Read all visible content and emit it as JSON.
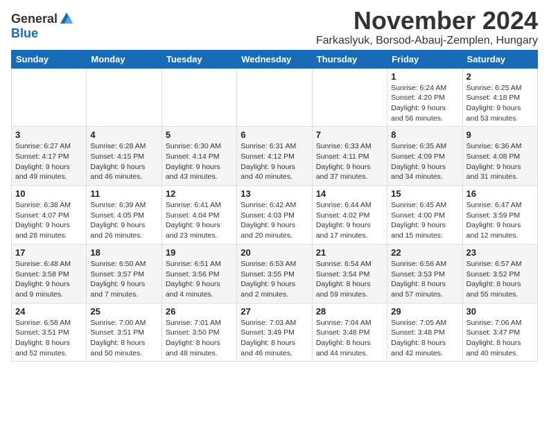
{
  "header": {
    "logo_general": "General",
    "logo_blue": "Blue",
    "month_year": "November 2024",
    "location": "Farkaslyuk, Borsod-Abauj-Zemplen, Hungary"
  },
  "weekdays": [
    "Sunday",
    "Monday",
    "Tuesday",
    "Wednesday",
    "Thursday",
    "Friday",
    "Saturday"
  ],
  "weeks": [
    [
      {
        "day": "",
        "info": ""
      },
      {
        "day": "",
        "info": ""
      },
      {
        "day": "",
        "info": ""
      },
      {
        "day": "",
        "info": ""
      },
      {
        "day": "",
        "info": ""
      },
      {
        "day": "1",
        "info": "Sunrise: 6:24 AM\nSunset: 4:20 PM\nDaylight: 9 hours\nand 56 minutes."
      },
      {
        "day": "2",
        "info": "Sunrise: 6:25 AM\nSunset: 4:18 PM\nDaylight: 9 hours\nand 53 minutes."
      }
    ],
    [
      {
        "day": "3",
        "info": "Sunrise: 6:27 AM\nSunset: 4:17 PM\nDaylight: 9 hours\nand 49 minutes."
      },
      {
        "day": "4",
        "info": "Sunrise: 6:28 AM\nSunset: 4:15 PM\nDaylight: 9 hours\nand 46 minutes."
      },
      {
        "day": "5",
        "info": "Sunrise: 6:30 AM\nSunset: 4:14 PM\nDaylight: 9 hours\nand 43 minutes."
      },
      {
        "day": "6",
        "info": "Sunrise: 6:31 AM\nSunset: 4:12 PM\nDaylight: 9 hours\nand 40 minutes."
      },
      {
        "day": "7",
        "info": "Sunrise: 6:33 AM\nSunset: 4:11 PM\nDaylight: 9 hours\nand 37 minutes."
      },
      {
        "day": "8",
        "info": "Sunrise: 6:35 AM\nSunset: 4:09 PM\nDaylight: 9 hours\nand 34 minutes."
      },
      {
        "day": "9",
        "info": "Sunrise: 6:36 AM\nSunset: 4:08 PM\nDaylight: 9 hours\nand 31 minutes."
      }
    ],
    [
      {
        "day": "10",
        "info": "Sunrise: 6:38 AM\nSunset: 4:07 PM\nDaylight: 9 hours\nand 28 minutes."
      },
      {
        "day": "11",
        "info": "Sunrise: 6:39 AM\nSunset: 4:05 PM\nDaylight: 9 hours\nand 26 minutes."
      },
      {
        "day": "12",
        "info": "Sunrise: 6:41 AM\nSunset: 4:04 PM\nDaylight: 9 hours\nand 23 minutes."
      },
      {
        "day": "13",
        "info": "Sunrise: 6:42 AM\nSunset: 4:03 PM\nDaylight: 9 hours\nand 20 minutes."
      },
      {
        "day": "14",
        "info": "Sunrise: 6:44 AM\nSunset: 4:02 PM\nDaylight: 9 hours\nand 17 minutes."
      },
      {
        "day": "15",
        "info": "Sunrise: 6:45 AM\nSunset: 4:00 PM\nDaylight: 9 hours\nand 15 minutes."
      },
      {
        "day": "16",
        "info": "Sunrise: 6:47 AM\nSunset: 3:59 PM\nDaylight: 9 hours\nand 12 minutes."
      }
    ],
    [
      {
        "day": "17",
        "info": "Sunrise: 6:48 AM\nSunset: 3:58 PM\nDaylight: 9 hours\nand 9 minutes."
      },
      {
        "day": "18",
        "info": "Sunrise: 6:50 AM\nSunset: 3:57 PM\nDaylight: 9 hours\nand 7 minutes."
      },
      {
        "day": "19",
        "info": "Sunrise: 6:51 AM\nSunset: 3:56 PM\nDaylight: 9 hours\nand 4 minutes."
      },
      {
        "day": "20",
        "info": "Sunrise: 6:53 AM\nSunset: 3:55 PM\nDaylight: 9 hours\nand 2 minutes."
      },
      {
        "day": "21",
        "info": "Sunrise: 6:54 AM\nSunset: 3:54 PM\nDaylight: 8 hours\nand 59 minutes."
      },
      {
        "day": "22",
        "info": "Sunrise: 6:56 AM\nSunset: 3:53 PM\nDaylight: 8 hours\nand 57 minutes."
      },
      {
        "day": "23",
        "info": "Sunrise: 6:57 AM\nSunset: 3:52 PM\nDaylight: 8 hours\nand 55 minutes."
      }
    ],
    [
      {
        "day": "24",
        "info": "Sunrise: 6:58 AM\nSunset: 3:51 PM\nDaylight: 8 hours\nand 52 minutes."
      },
      {
        "day": "25",
        "info": "Sunrise: 7:00 AM\nSunset: 3:51 PM\nDaylight: 8 hours\nand 50 minutes."
      },
      {
        "day": "26",
        "info": "Sunrise: 7:01 AM\nSunset: 3:50 PM\nDaylight: 8 hours\nand 48 minutes."
      },
      {
        "day": "27",
        "info": "Sunrise: 7:03 AM\nSunset: 3:49 PM\nDaylight: 8 hours\nand 46 minutes."
      },
      {
        "day": "28",
        "info": "Sunrise: 7:04 AM\nSunset: 3:48 PM\nDaylight: 8 hours\nand 44 minutes."
      },
      {
        "day": "29",
        "info": "Sunrise: 7:05 AM\nSunset: 3:48 PM\nDaylight: 8 hours\nand 42 minutes."
      },
      {
        "day": "30",
        "info": "Sunrise: 7:06 AM\nSunset: 3:47 PM\nDaylight: 8 hours\nand 40 minutes."
      }
    ]
  ]
}
